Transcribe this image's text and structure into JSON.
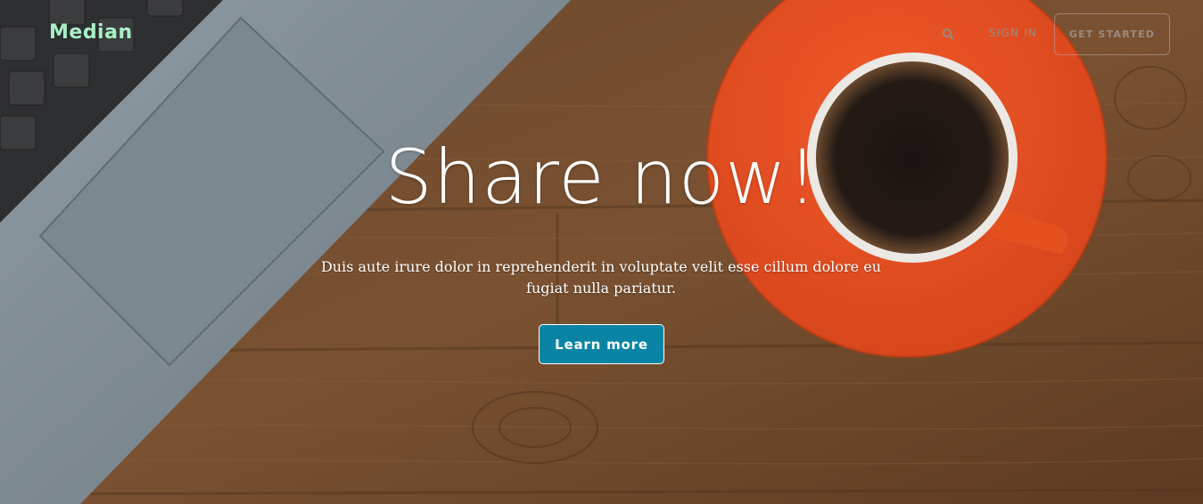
{
  "nav": {
    "logo": "Median",
    "search_icon": "search-icon",
    "sign_in": "SIGN IN",
    "get_started": "GET STARTED"
  },
  "hero": {
    "headline": "Share now!",
    "subtext": "Duis aute irure dolor in reprehenderit in voluptate velit esse cillum dolore eu fugiat nulla pariatur.",
    "cta": "Learn more"
  },
  "colors": {
    "logo": "#a8f0c4",
    "cta_background": "#0a84a4",
    "nav_text": "#9a8a80",
    "headline": "#ffffff"
  }
}
